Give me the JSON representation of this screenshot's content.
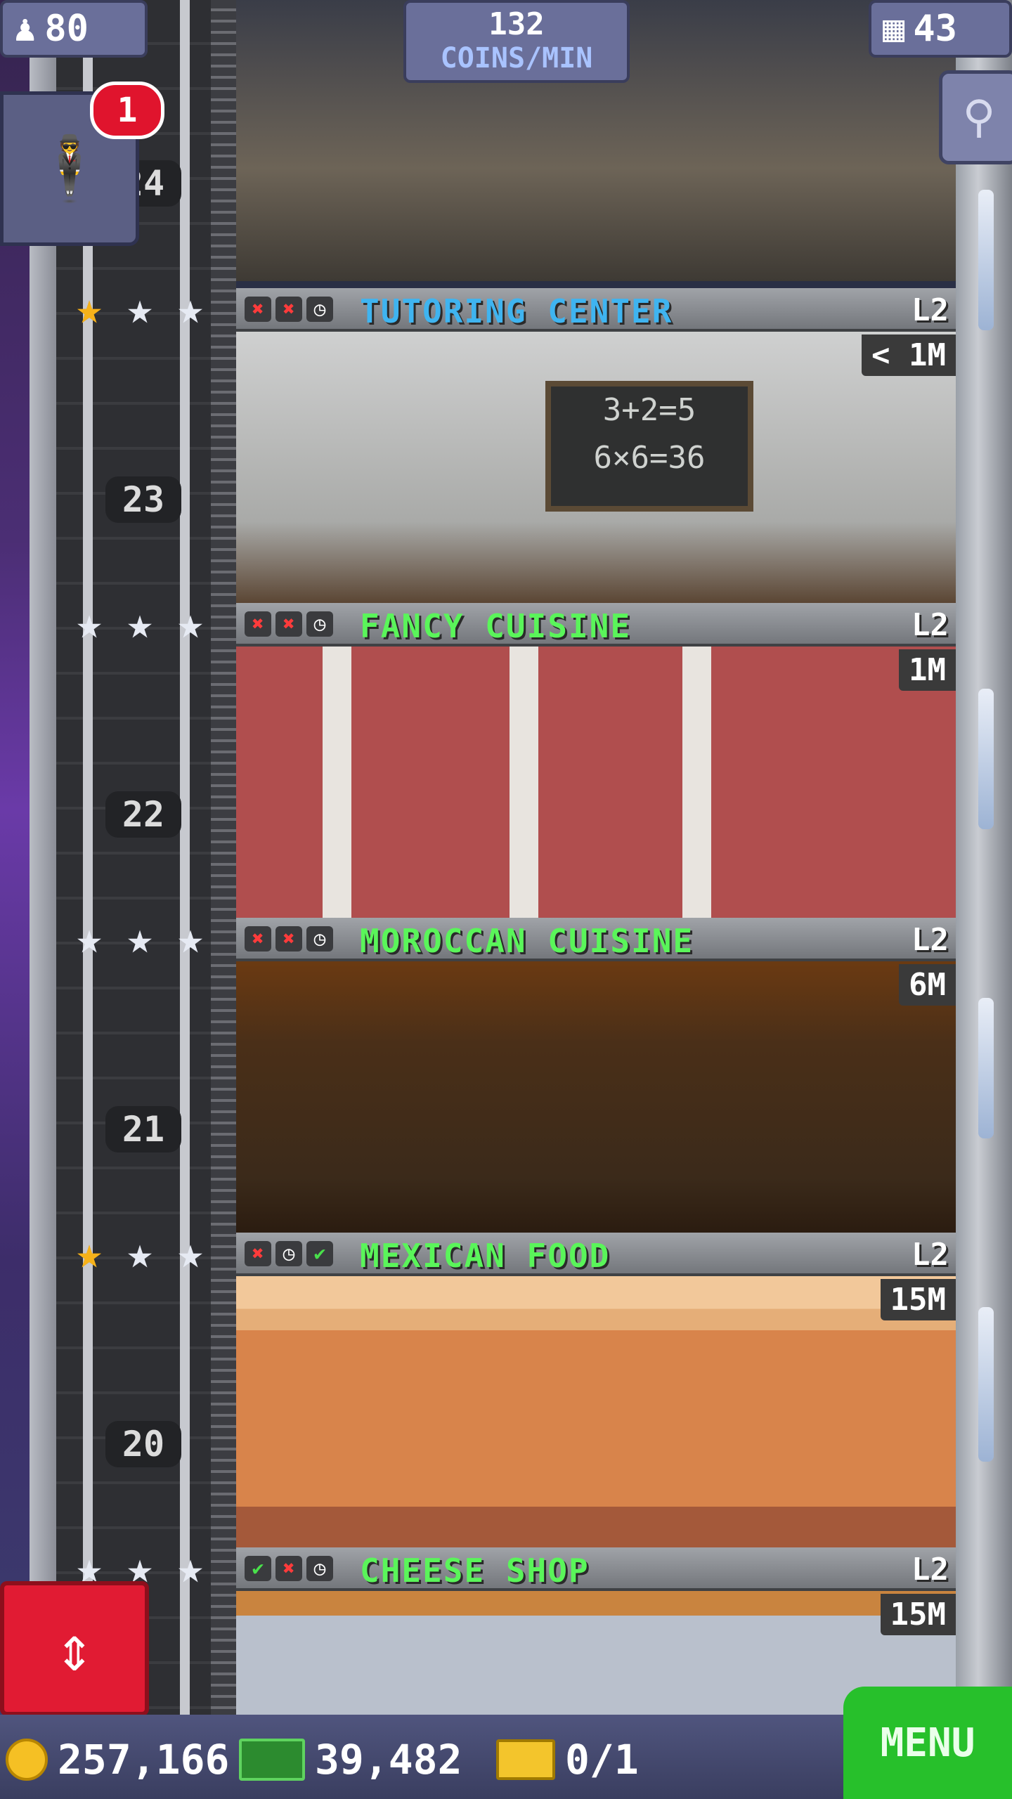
{
  "hud": {
    "population": "80",
    "coins_rate_value": "132",
    "coins_rate_unit": "COINS/MIN",
    "floor_count": "43"
  },
  "vip": {
    "notification_count": "1"
  },
  "top_floor": {
    "number": "24"
  },
  "floors": [
    {
      "number": "23",
      "name": "TUTORING CENTER",
      "level": "L2",
      "restock": "< 1M",
      "slots": [
        "x",
        "x",
        "clock"
      ],
      "stars": [
        "gold",
        "silver",
        "silver"
      ],
      "name_color": "blue"
    },
    {
      "number": "22",
      "name": "FANCY CUISINE",
      "level": "L2",
      "restock": "1M",
      "slots": [
        "x",
        "x",
        "clock"
      ],
      "stars": [
        "silver",
        "silver",
        "silver"
      ],
      "name_color": "green"
    },
    {
      "number": "21",
      "name": "MOROCCAN CUISINE",
      "level": "L2",
      "restock": "6M",
      "slots": [
        "x",
        "x",
        "clock"
      ],
      "stars": [
        "silver",
        "silver",
        "silver"
      ],
      "name_color": "green"
    },
    {
      "number": "20",
      "name": "MEXICAN FOOD",
      "level": "L2",
      "restock": "15M",
      "slots": [
        "x",
        "clock",
        "check"
      ],
      "stars": [
        "gold",
        "silver",
        "silver"
      ],
      "name_color": "green"
    },
    {
      "number": "",
      "name": "CHEESE SHOP",
      "level": "L2",
      "restock": "15M",
      "slots": [
        "check",
        "x",
        "clock"
      ],
      "stars": [
        "silver",
        "silver",
        "silver"
      ],
      "name_color": "green"
    }
  ],
  "wallet": {
    "coins": "257,166",
    "bux": "39,482",
    "tickets": "0/1"
  },
  "menu_label": "MENU",
  "icons": {
    "population": "person-icon",
    "floors": "building-icon",
    "search": "magnifier-icon",
    "elevator": "up-down-arrows-icon",
    "coin": "coin-icon",
    "bux": "bux-bill-icon",
    "ticket": "golden-ticket-icon"
  },
  "colors": {
    "floor_name_blue": "#3fb4f0",
    "floor_name_green": "#5af55a",
    "star_gold": "#f6b21a",
    "menu_green": "#27c02b",
    "elevator_red": "#e11b33"
  }
}
